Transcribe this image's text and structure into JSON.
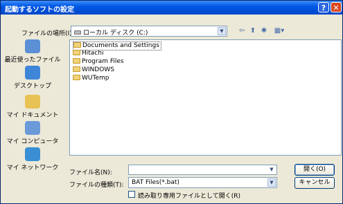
{
  "window": {
    "title": "起動するソフトの設定",
    "help": "?",
    "close": "✕"
  },
  "location": {
    "label": "ファイルの場所(I):",
    "value": "ローカル ディスク (C:)"
  },
  "toolbar": {
    "back": "⇦",
    "up": "⬆",
    "new_folder": "✱",
    "view": "▦▾"
  },
  "places": [
    {
      "label": "最近使ったファイル",
      "icon": "recent-documents-icon",
      "color": "#5b8fd6"
    },
    {
      "label": "デスクトップ",
      "icon": "desktop-icon",
      "color": "#3f86d8"
    },
    {
      "label": "マイ ドキュメント",
      "icon": "my-documents-icon",
      "color": "#e9c256"
    },
    {
      "label": "マイ コンピュータ",
      "icon": "my-computer-icon",
      "color": "#6a9ad8"
    },
    {
      "label": "マイ ネットワーク",
      "icon": "my-network-icon",
      "color": "#3a8fd4"
    }
  ],
  "files": [
    {
      "name": "Documents and Settings"
    },
    {
      "name": "Hitachi"
    },
    {
      "name": "Program Files"
    },
    {
      "name": "WINDOWS"
    },
    {
      "name": "WUTemp"
    }
  ],
  "filename": {
    "label": "ファイル名(N):",
    "value": ""
  },
  "filetype": {
    "label": "ファイルの種類(T):",
    "value": "BAT Files(*.bat)"
  },
  "readonly": {
    "label": "読み取り専用ファイルとして開く(R)",
    "checked": false
  },
  "buttons": {
    "open": "開く(O)",
    "cancel": "キャンセル"
  }
}
